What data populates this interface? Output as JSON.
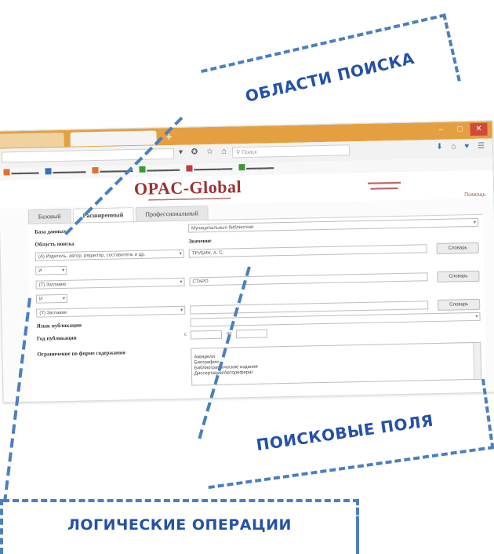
{
  "callouts": {
    "areas": "ОБЛАСТИ ПОИСКА",
    "fields": "ПОИСКОВЫЕ ПОЛЯ",
    "logic": "ЛОГИЧЕСКИЕ ОПЕРАЦИИ"
  },
  "browser": {
    "search_placeholder": "Поиск"
  },
  "page": {
    "logo": "OPAC-Global",
    "tabs": [
      "Базовый",
      "Расширенный",
      "Профессиональный"
    ],
    "help": "Помощь"
  },
  "form": {
    "database_label": "База данных",
    "database_value": "Муниципальные библиотеки",
    "area_label": "Область поиска",
    "value_label": "Значение",
    "row1_area": "(А) Издатель, автор, редактор, составитель и др.",
    "row1_value": "ТРУБИН, А. С.",
    "row2_area": "(Т) Заглавие",
    "row2_value": "СТАРО",
    "row3_area": "(Т) Заглавие",
    "row3_value": "",
    "logic1": "И",
    "logic2": "И",
    "dict_button": "Словарь",
    "lang_label": "Язык публикации",
    "year_label": "Год публикации",
    "year_from": "с",
    "year_to": "по",
    "content_label": "Ограничение по форме содержания",
    "content_options": [
      "Акварели",
      "Биографии",
      "Библиографические издания",
      "Диссертации/Автореферат"
    ]
  },
  "colors": {
    "accent": "#4a7fc0",
    "callout_text": "#2451a8",
    "logo": "#a03030",
    "titlebar": "#e4a040"
  }
}
